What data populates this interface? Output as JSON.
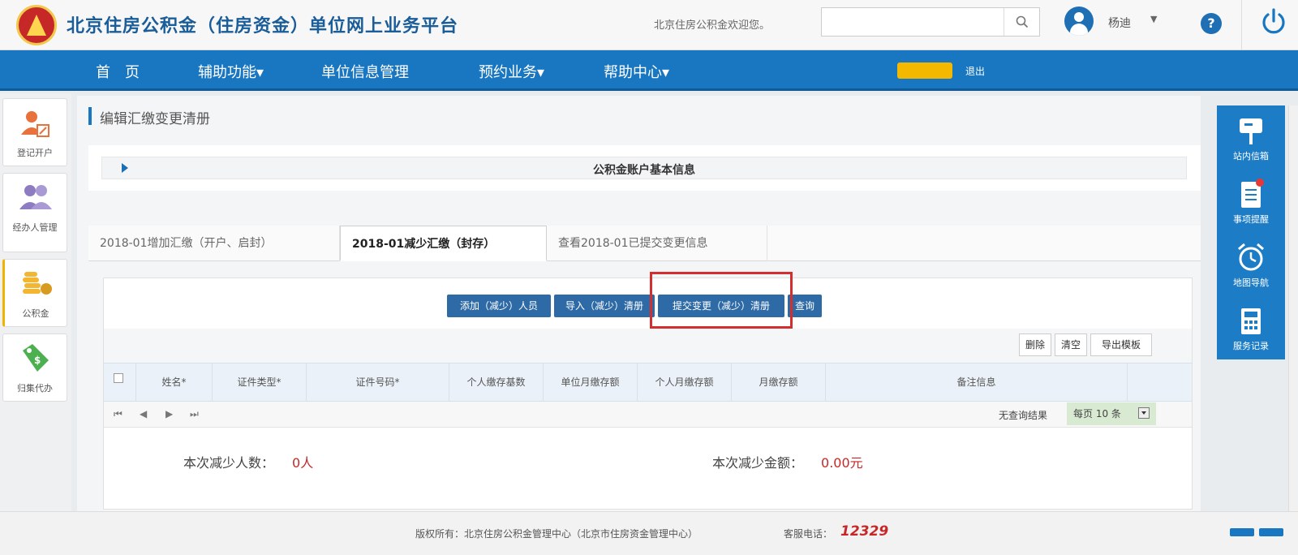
{
  "header": {
    "title": "北京住房公积金（住房资金）单位网上业务平台",
    "welcome": "北京住房公积金欢迎您。",
    "search_placeholder": "",
    "username": "杨迪"
  },
  "nav": {
    "items": [
      "首　页",
      "辅助功能▾",
      "单位信息管理",
      "预约业务▾",
      "帮助中心▾"
    ],
    "badge": "",
    "exit": "退出"
  },
  "left_sidebar": {
    "items": [
      {
        "label": "登记开户",
        "icon": "register-icon"
      },
      {
        "label": "经办人管理",
        "icon": "users-icon"
      },
      {
        "label": "公积金",
        "icon": "coins-icon"
      },
      {
        "label": "归集代办",
        "icon": "tag-icon"
      }
    ],
    "active_index": 2
  },
  "right_sidebar": {
    "items": [
      {
        "label": "站内信箱",
        "icon": "mailbox-icon"
      },
      {
        "label": "事项提醒",
        "icon": "document-icon"
      },
      {
        "label": "地图导航",
        "icon": "alarm-clock-icon"
      },
      {
        "label": "服务记录",
        "icon": "calculator-icon"
      }
    ]
  },
  "page": {
    "title": "编辑汇缴变更清册",
    "account_section": "公积金账户基本信息"
  },
  "tabs": [
    {
      "label": "2018-01增加汇缴（开户、启封）",
      "active": false
    },
    {
      "label": "2018-01减少汇缴（封存）",
      "active": true
    },
    {
      "label": "查看2018-01已提交变更信息",
      "active": false
    }
  ],
  "actions": {
    "add": "添加（减少）人员",
    "import": "导入（减少）清册",
    "submit": "提交变更（减少）清册",
    "query": "查询"
  },
  "toolbar": {
    "delete": "删除",
    "clear": "清空",
    "export_template": "导出模板"
  },
  "table": {
    "columns": [
      "姓名*",
      "证件类型*",
      "证件号码*",
      "个人缴存基数",
      "单位月缴存额",
      "个人月缴存额",
      "月缴存额",
      "备注信息"
    ]
  },
  "pager": {
    "info": "无查询结果",
    "per_page": "每页 10 条"
  },
  "summary": {
    "count_label": "本次减少人数：",
    "count_value": "0人",
    "amount_label": "本次减少金额：",
    "amount_value": "0.00元"
  },
  "footer": {
    "copyright": "版权所有：北京住房公积金管理中心（北京市住房资金管理中心）",
    "hotline_label": "客服电话：",
    "hotline_number": "12329"
  },
  "colors": {
    "brand_blue": "#1976c0",
    "button_blue": "#2d6aa6",
    "highlight_red": "#d32f2f",
    "value_red": "#c62828"
  }
}
